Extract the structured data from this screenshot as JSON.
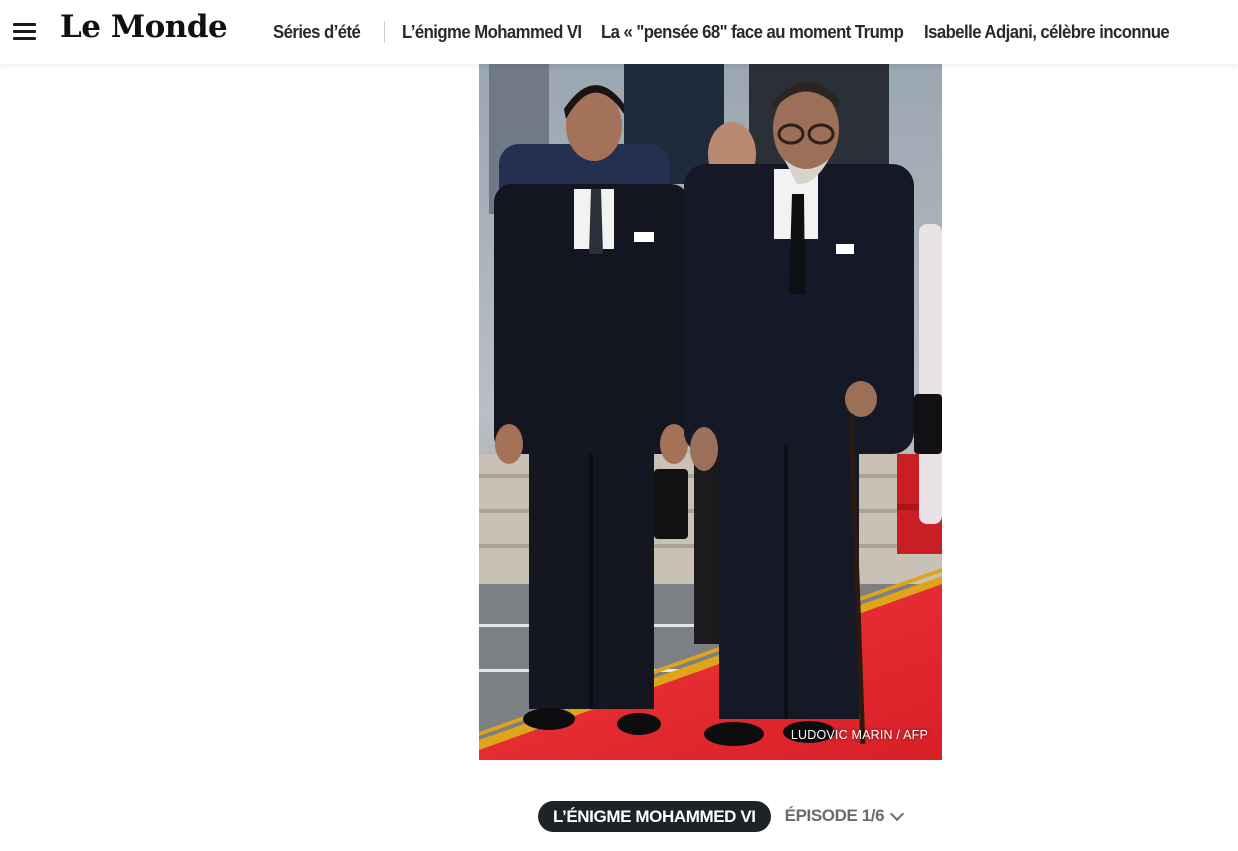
{
  "header": {
    "logo": "Le Monde",
    "nav": [
      {
        "label": "Séries d’été"
      },
      {
        "label": "L’énigme Mohammed VI"
      },
      {
        "label": "La « \"pensée 68\" face au moment Trump"
      },
      {
        "label": "Isabelle Adjani, célèbre inconnue"
      }
    ]
  },
  "article": {
    "photo_credit": "LUDOVIC MARIN / AFP",
    "series_label": "L’ÉNIGME MOHAMMED VI",
    "episode_label": "ÉPISODE 1/6"
  },
  "colors": {
    "pill_background": "#1f2328",
    "carpet_red": "#e8282d",
    "text_dark": "#2a2a2a",
    "text_muted": "#6b6b6b"
  },
  "icons": {
    "menu": "hamburger-menu-icon",
    "episode_dropdown": "chevron-down-icon"
  }
}
